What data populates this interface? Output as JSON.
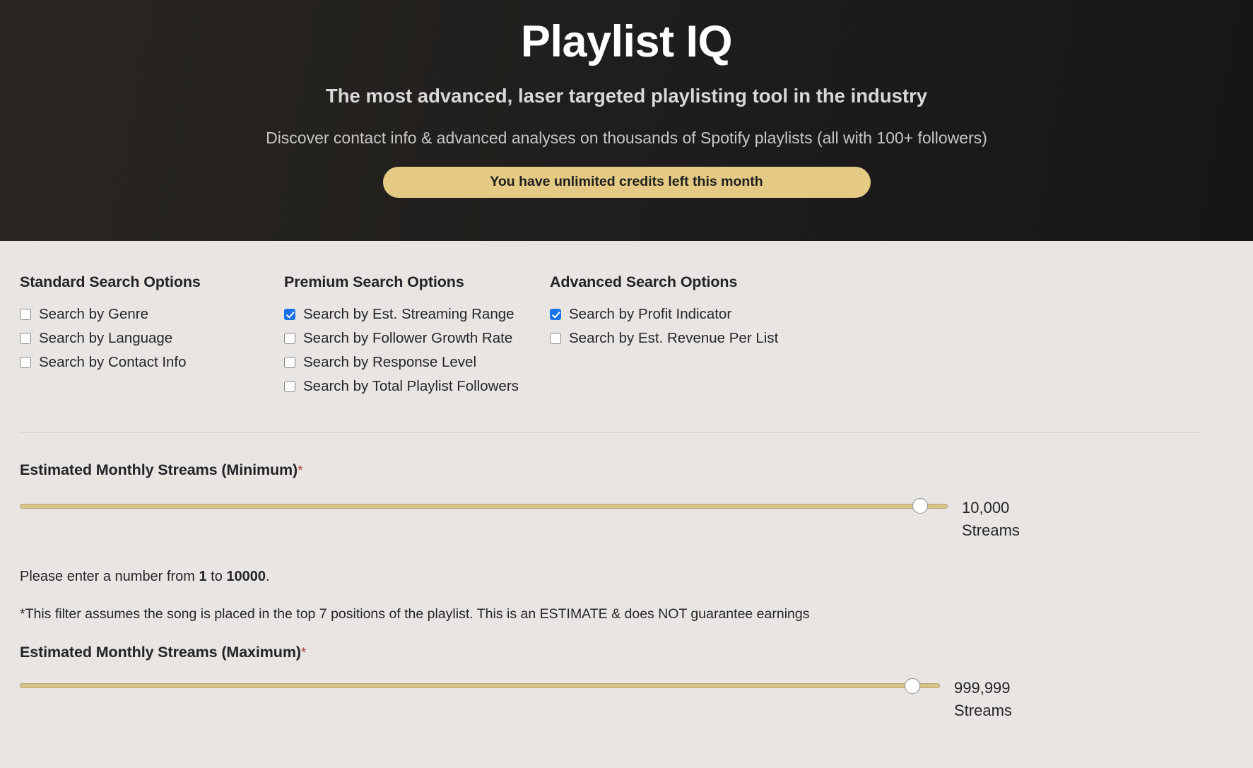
{
  "hero": {
    "title": "Playlist IQ",
    "subtitle": "The most advanced, laser targeted playlisting tool in the industry",
    "description": "Discover contact info & advanced analyses on thousands of Spotify playlists (all with 100+ followers)",
    "credits_label": "You have unlimited credits left this month",
    "credits_bg": "#e4ca85"
  },
  "options": {
    "standard": {
      "heading": "Standard Search Options",
      "items": [
        {
          "label": "Search by Genre",
          "checked": false
        },
        {
          "label": "Search by Language",
          "checked": false
        },
        {
          "label": "Search by Contact Info",
          "checked": false
        }
      ]
    },
    "premium": {
      "heading": "Premium Search Options",
      "items": [
        {
          "label": "Search by Est. Streaming Range",
          "checked": true
        },
        {
          "label": "Search by Follower Growth Rate",
          "checked": false
        },
        {
          "label": "Search by Response Level",
          "checked": false
        },
        {
          "label": "Search by Total Playlist Followers",
          "checked": false
        }
      ]
    },
    "advanced": {
      "heading": "Advanced Search Options",
      "items": [
        {
          "label": "Search by Profit Indicator",
          "checked": true
        },
        {
          "label": "Search by Est. Revenue Per List",
          "checked": false
        }
      ]
    },
    "checked_color": "#1a73e8"
  },
  "min_streams": {
    "label": "Estimated Monthly Streams (Minimum)",
    "required_mark": "*",
    "value": "10,000",
    "unit": "Streams",
    "range_min": "1",
    "range_max": "10000",
    "help_prefix": "Please enter a number from ",
    "help_mid": " to ",
    "help_suffix": ".",
    "note": "*This filter assumes the song is placed in the top 7 positions of the playlist. This is an ESTIMATE & does NOT guarantee earnings",
    "track_color": "#d9c38b",
    "fill_percent": 97
  },
  "max_streams": {
    "label": "Estimated Monthly Streams (Maximum)",
    "required_mark": "*",
    "value": "999,999",
    "unit": "Streams",
    "track_color": "#d9c38b",
    "fill_percent": 97
  }
}
